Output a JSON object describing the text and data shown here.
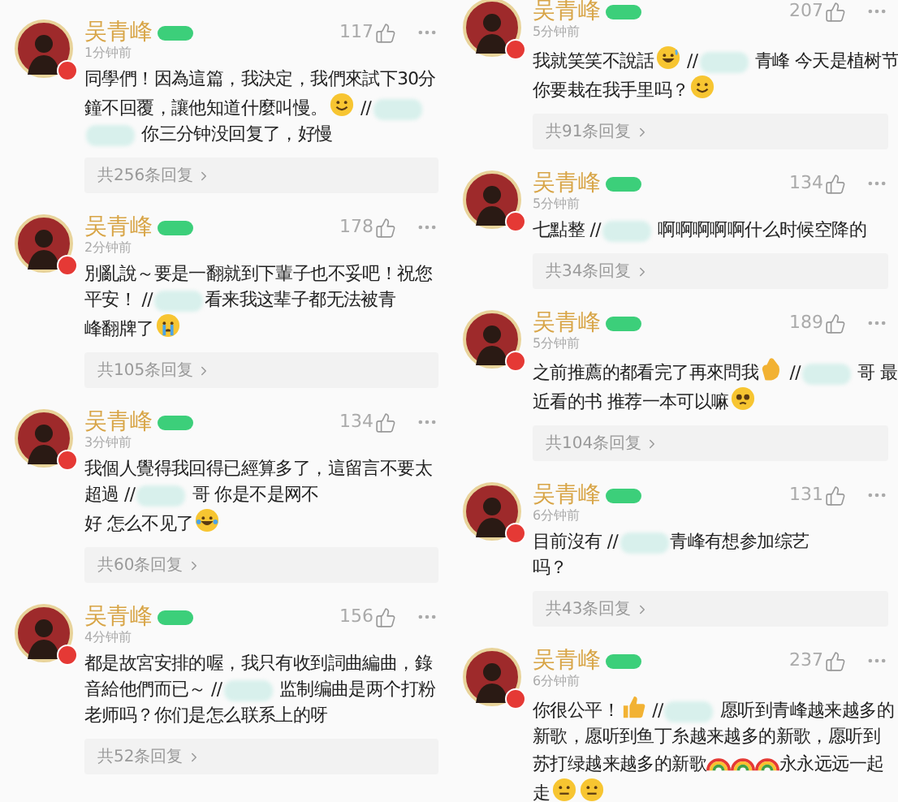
{
  "columns": [
    {
      "comments": [
        {
          "name": "吴青峰",
          "time": "1分钟前",
          "likes": "117",
          "lines": [
            [
              {
                "kind": "text",
                "text": "同學們！因為這篇，我決定，我們來試下30分"
              }
            ],
            [
              {
                "kind": "text",
                "text": "鐘不回覆，讓他知道什麼叫慢。"
              },
              {
                "kind": "smile"
              },
              {
                "kind": "text",
                "text": " //"
              },
              {
                "kind": "redacted"
              }
            ],
            [
              {
                "kind": "redacted"
              },
              {
                "kind": "text",
                "text": " 你三分钟没回复了，好慢"
              }
            ]
          ],
          "replies": "共256条回复"
        },
        {
          "name": "吴青峰",
          "time": "2分钟前",
          "likes": "178",
          "lines": [
            [
              {
                "kind": "text",
                "text": "別亂說～要是一翻就到下輩子也不妥吧！祝您"
              }
            ],
            [
              {
                "kind": "text",
                "text": "平安！ //"
              },
              {
                "kind": "redacted"
              },
              {
                "kind": "text",
                "text": "看来我这辈子都无法被青"
              }
            ],
            [
              {
                "kind": "text",
                "text": "峰翻牌了"
              },
              {
                "kind": "cry"
              }
            ]
          ],
          "replies": "共105条回复"
        },
        {
          "name": "吴青峰",
          "time": "3分钟前",
          "likes": "134",
          "lines": [
            [
              {
                "kind": "text",
                "text": "我個人覺得我回得已經算多了，這留言不要太"
              }
            ],
            [
              {
                "kind": "text",
                "text": "超過 //"
              },
              {
                "kind": "redacted"
              },
              {
                "kind": "text",
                "text": " 哥 你是不是网不"
              }
            ],
            [
              {
                "kind": "text",
                "text": "好 怎么不见了"
              },
              {
                "kind": "laugh-cry"
              }
            ]
          ],
          "replies": "共60条回复"
        },
        {
          "name": "吴青峰",
          "time": "4分钟前",
          "likes": "156",
          "lines": [
            [
              {
                "kind": "text",
                "text": "都是故宮安排的喔，我只有收到詞曲編曲，錄"
              }
            ],
            [
              {
                "kind": "text",
                "text": "音給他們而已～ //"
              },
              {
                "kind": "redacted"
              },
              {
                "kind": "text",
                "text": " 监制编曲是两个打粉"
              }
            ],
            [
              {
                "kind": "text",
                "text": "老师吗？你们是怎么联系上的呀"
              }
            ]
          ],
          "replies": "共52条回复"
        }
      ]
    },
    {
      "comments": [
        {
          "name": "吴青峰",
          "time": "5分钟前",
          "likes": "207",
          "lines": [
            [
              {
                "kind": "text",
                "text": "我就笑笑不說話"
              },
              {
                "kind": "grin"
              },
              {
                "kind": "text",
                "text": " //"
              },
              {
                "kind": "redacted"
              },
              {
                "kind": "text",
                "text": " 青峰 今天是植树节"
              }
            ],
            [
              {
                "kind": "text",
                "text": "你要栽在我手里吗？"
              },
              {
                "kind": "smile"
              }
            ]
          ],
          "replies": "共91条回复"
        },
        {
          "name": "吴青峰",
          "time": "5分钟前",
          "likes": "134",
          "lines": [
            [
              {
                "kind": "text",
                "text": "七點整 //"
              },
              {
                "kind": "redacted"
              },
              {
                "kind": "text",
                "text": " 啊啊啊啊啊什么时候空降的"
              }
            ]
          ],
          "replies": "共34条回复"
        },
        {
          "name": "吴青峰",
          "time": "5分钟前",
          "likes": "189",
          "lines": [
            [
              {
                "kind": "text",
                "text": "之前推薦的都看完了再來問我"
              },
              {
                "kind": "clap"
              },
              {
                "kind": "text",
                "text": " //"
              },
              {
                "kind": "redacted"
              },
              {
                "kind": "text",
                "text": " 哥 最"
              }
            ],
            [
              {
                "kind": "text",
                "text": "近看的书 推荐一本可以嘛"
              },
              {
                "kind": "pleading"
              }
            ]
          ],
          "replies": "共104条回复"
        },
        {
          "name": "吴青峰",
          "time": "6分钟前",
          "likes": "131",
          "lines": [
            [
              {
                "kind": "text",
                "text": "目前沒有 //"
              },
              {
                "kind": "redacted"
              },
              {
                "kind": "text",
                "text": "青峰有想参加综艺"
              }
            ],
            [
              {
                "kind": "text",
                "text": "吗？"
              }
            ]
          ],
          "replies": "共43条回复"
        },
        {
          "name": "吴青峰",
          "time": "6分钟前",
          "likes": "237",
          "lines": [
            [
              {
                "kind": "text",
                "text": "你很公平！"
              },
              {
                "kind": "thumbs-up"
              },
              {
                "kind": "text",
                "text": " //"
              },
              {
                "kind": "redacted"
              },
              {
                "kind": "text",
                "text": " 愿听到青峰越来越多的"
              }
            ],
            [
              {
                "kind": "text",
                "text": "新歌，愿听到鱼丁糸越来越多的新歌，愿听到"
              }
            ],
            [
              {
                "kind": "text",
                "text": "苏打绿越来越多的新歌"
              },
              {
                "kind": "rainbow"
              },
              {
                "kind": "rainbow"
              },
              {
                "kind": "rainbow"
              },
              {
                "kind": "text",
                "text": "永永远远一起"
              }
            ],
            [
              {
                "kind": "text",
                "text": "走"
              },
              {
                "kind": "neutral"
              },
              {
                "kind": "neutral"
              }
            ]
          ]
        }
      ]
    }
  ]
}
